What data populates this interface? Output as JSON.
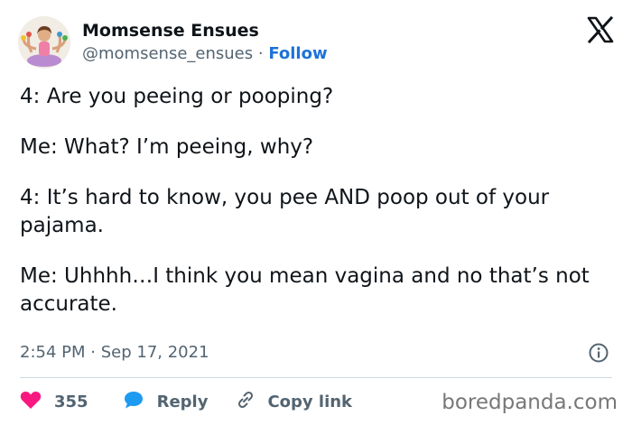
{
  "author": {
    "name": "Momsense Ensues",
    "handle": "@momsense_ensues",
    "separator": "·",
    "follow_label": "Follow"
  },
  "tweet": {
    "paragraphs": [
      "4: Are you peeing or pooping?",
      "Me: What? I’m peeing, why?",
      "4: It’s hard to know, you pee AND poop out of your pajama.",
      "Me: Uhhhh…I think you mean vagina and no that’s not accurate."
    ],
    "time": "2:54 PM",
    "dot": "·",
    "date": "Sep 17, 2021"
  },
  "actions": {
    "like_count": "355",
    "reply_label": "Reply",
    "copy_label": "Copy link"
  },
  "watermark": "boredpanda.com",
  "colors": {
    "accent": "#1d73d8",
    "heart": "#f91880",
    "muted": "#536471",
    "divider": "#cfd9de"
  },
  "icons": [
    "x-logo-icon",
    "info-icon",
    "heart-icon",
    "reply-icon",
    "link-icon"
  ]
}
